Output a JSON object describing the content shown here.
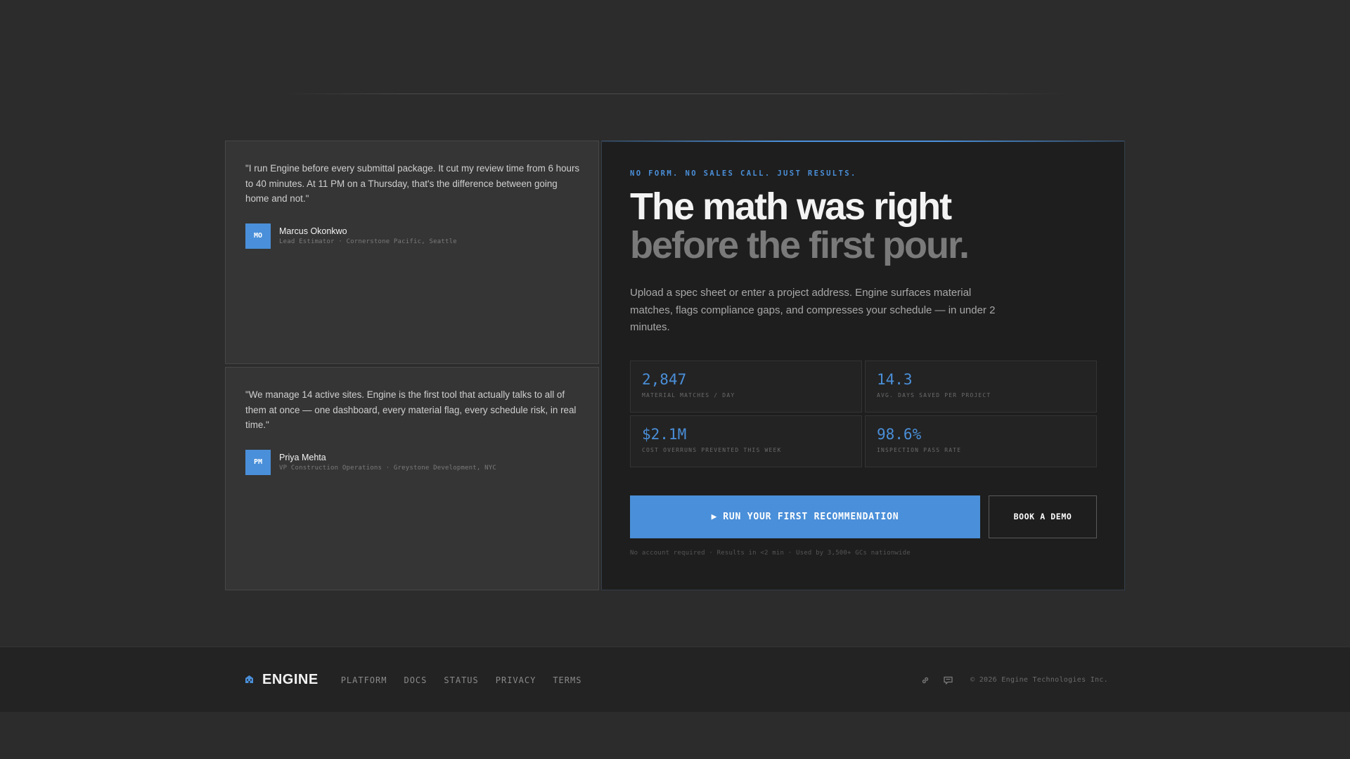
{
  "testimonials": [
    {
      "quote": "\"I run Engine before every submittal package. It cut my review time from 6 hours to 40 minutes. At 11 PM on a Thursday, that's the difference between going home and not.\"",
      "initials": "MO",
      "name": "Marcus Okonkwo",
      "role": "Lead Estimator · Cornerstone Pacific, Seattle"
    },
    {
      "quote": "\"We manage 14 active sites. Engine is the first tool that actually talks to all of them at once — one dashboard, every material flag, every schedule risk, in real time.\"",
      "initials": "PM",
      "name": "Priya Mehta",
      "role": "VP Construction Operations · Greystone Development, NYC"
    }
  ],
  "hero": {
    "eyebrow": "NO FORM. NO SALES CALL. JUST RESULTS.",
    "headline_line1": "The math was right",
    "headline_line2": "before the first pour.",
    "lede": "Upload a spec sheet or enter a project address. Engine surfaces material matches, flags compliance gaps, and compresses your schedule — in under 2 minutes.",
    "stats": [
      {
        "value": "2,847",
        "label": "MATERIAL MATCHES / DAY"
      },
      {
        "value": "14.3",
        "label": "AVG. DAYS SAVED PER PROJECT"
      },
      {
        "value": "$2.1M",
        "label": "COST OVERRUNS PREVENTED THIS WEEK"
      },
      {
        "value": "98.6%",
        "label": "INSPECTION PASS RATE"
      }
    ],
    "cta_primary_icon": "▶",
    "cta_primary": "RUN YOUR FIRST RECOMMENDATION",
    "cta_secondary": "BOOK A DEMO",
    "fineprint": "No account required · Results in <2 min · Used by 3,500+ GCs nationwide"
  },
  "footer": {
    "brand_icon": "building-icon",
    "brand_name": "ENGINE",
    "nav": [
      "PLATFORM",
      "DOCS",
      "STATUS",
      "PRIVACY",
      "TERMS"
    ],
    "icons": [
      "link-icon",
      "chat-icon"
    ],
    "copyright": "© 2026 Engine Technologies Inc."
  },
  "colors": {
    "accent": "#4a8fd9",
    "background": "#2c2c2c",
    "hero_background": "#1e1e1e",
    "card_background": "#353535"
  }
}
